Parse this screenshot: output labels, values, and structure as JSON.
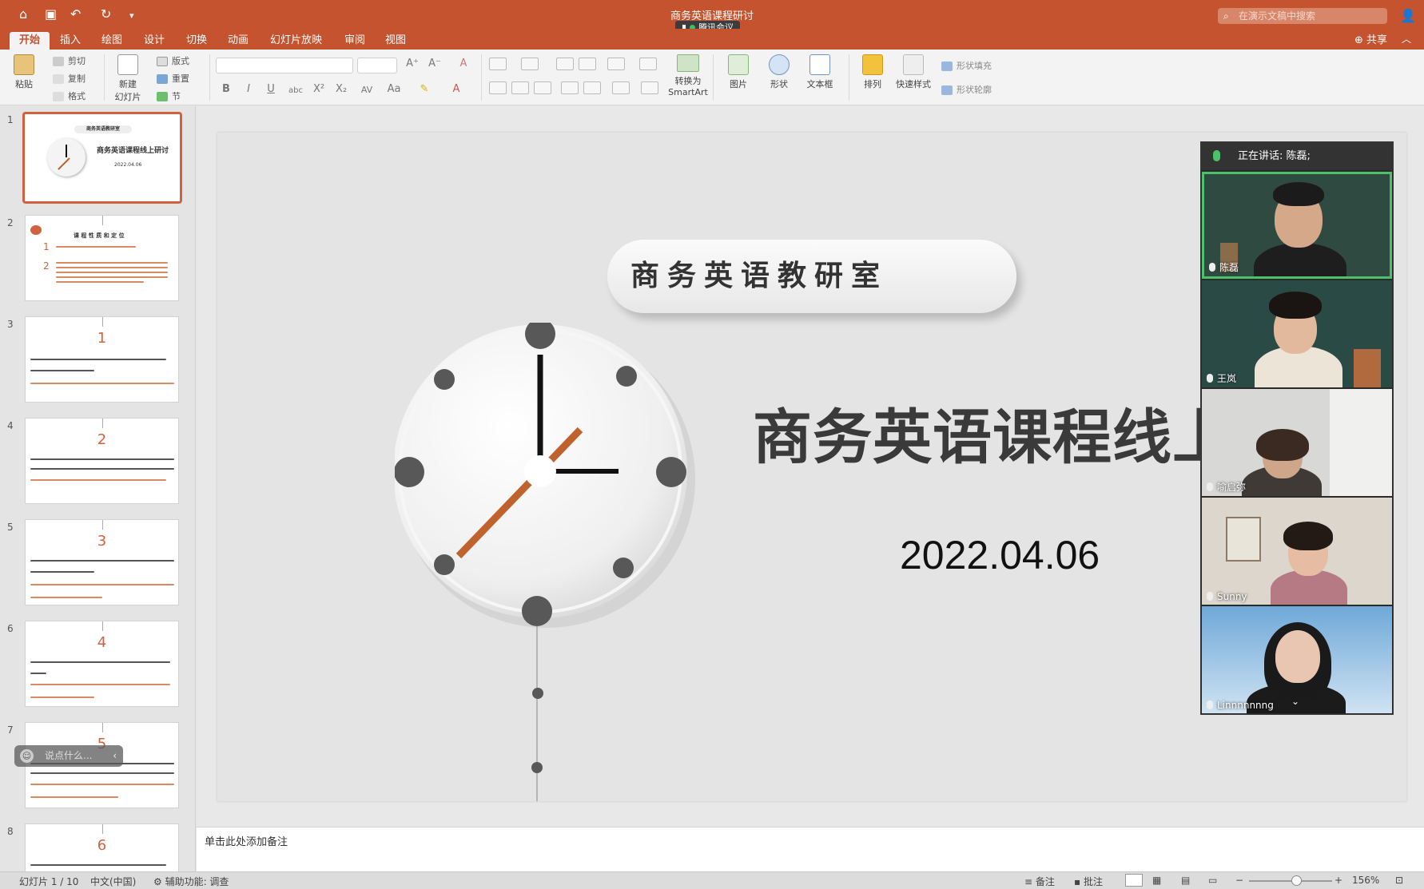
{
  "window": {
    "title": "商务英语课程研讨",
    "meeting_badge": "腾讯会议",
    "search_placeholder": "在演示文稿中搜索",
    "share_label": "共享"
  },
  "tabs": [
    "开始",
    "插入",
    "绘图",
    "设计",
    "切换",
    "动画",
    "幻灯片放映",
    "审阅",
    "视图"
  ],
  "ribbon": {
    "paste": "粘贴",
    "cut": "剪切",
    "copy": "复制",
    "format": "格式",
    "new_slide_1": "新建",
    "new_slide_2": "幻灯片",
    "layout": "版式",
    "reset": "重置",
    "section": "节",
    "convert_1": "转换为",
    "convert_2": "SmartArt",
    "picture": "图片",
    "shape": "形状",
    "textbox": "文本框",
    "arrange": "排列",
    "quick_styles": "快速样式",
    "shape_fill": "形状填充",
    "shape_outline": "形状轮廓"
  },
  "thumbnails": [
    {
      "num": "1",
      "title": "商务英语课程线上研讨",
      "date": "2022.04.06",
      "header": "商务英语教研室"
    },
    {
      "num": "2",
      "title": "课 程 性 质 和 定 位",
      "n1": "1",
      "n2": "2"
    },
    {
      "num": "3",
      "big": "1"
    },
    {
      "num": "4",
      "big": "2"
    },
    {
      "num": "5",
      "big": "3"
    },
    {
      "num": "6",
      "big": "4"
    },
    {
      "num": "7",
      "big": "5"
    },
    {
      "num": "8",
      "big": "6"
    }
  ],
  "chat_popup": "说点什么...",
  "slide": {
    "banner": "商务英语教研室",
    "title": "商务英语课程线上研讨",
    "date": "2022.04.06"
  },
  "video_panel": {
    "speaking": "正在讲话: 陈磊;",
    "participants": [
      {
        "name": "陈磊"
      },
      {
        "name": "王岚"
      },
      {
        "name": "喻启弥"
      },
      {
        "name": "Sunny"
      },
      {
        "name": "Linnnnnnng"
      }
    ]
  },
  "notes_placeholder": "单击此处添加备注",
  "status": {
    "slide_info": "幻灯片 1 / 10",
    "language": "中文(中国)",
    "accessibility": "辅助功能: 调查",
    "notes": "备注",
    "comments": "批注",
    "zoom": "156%"
  },
  "colors": {
    "accent": "#c5532f",
    "clock_hand": "#c0622e",
    "active_speaker": "#4cc16a"
  }
}
